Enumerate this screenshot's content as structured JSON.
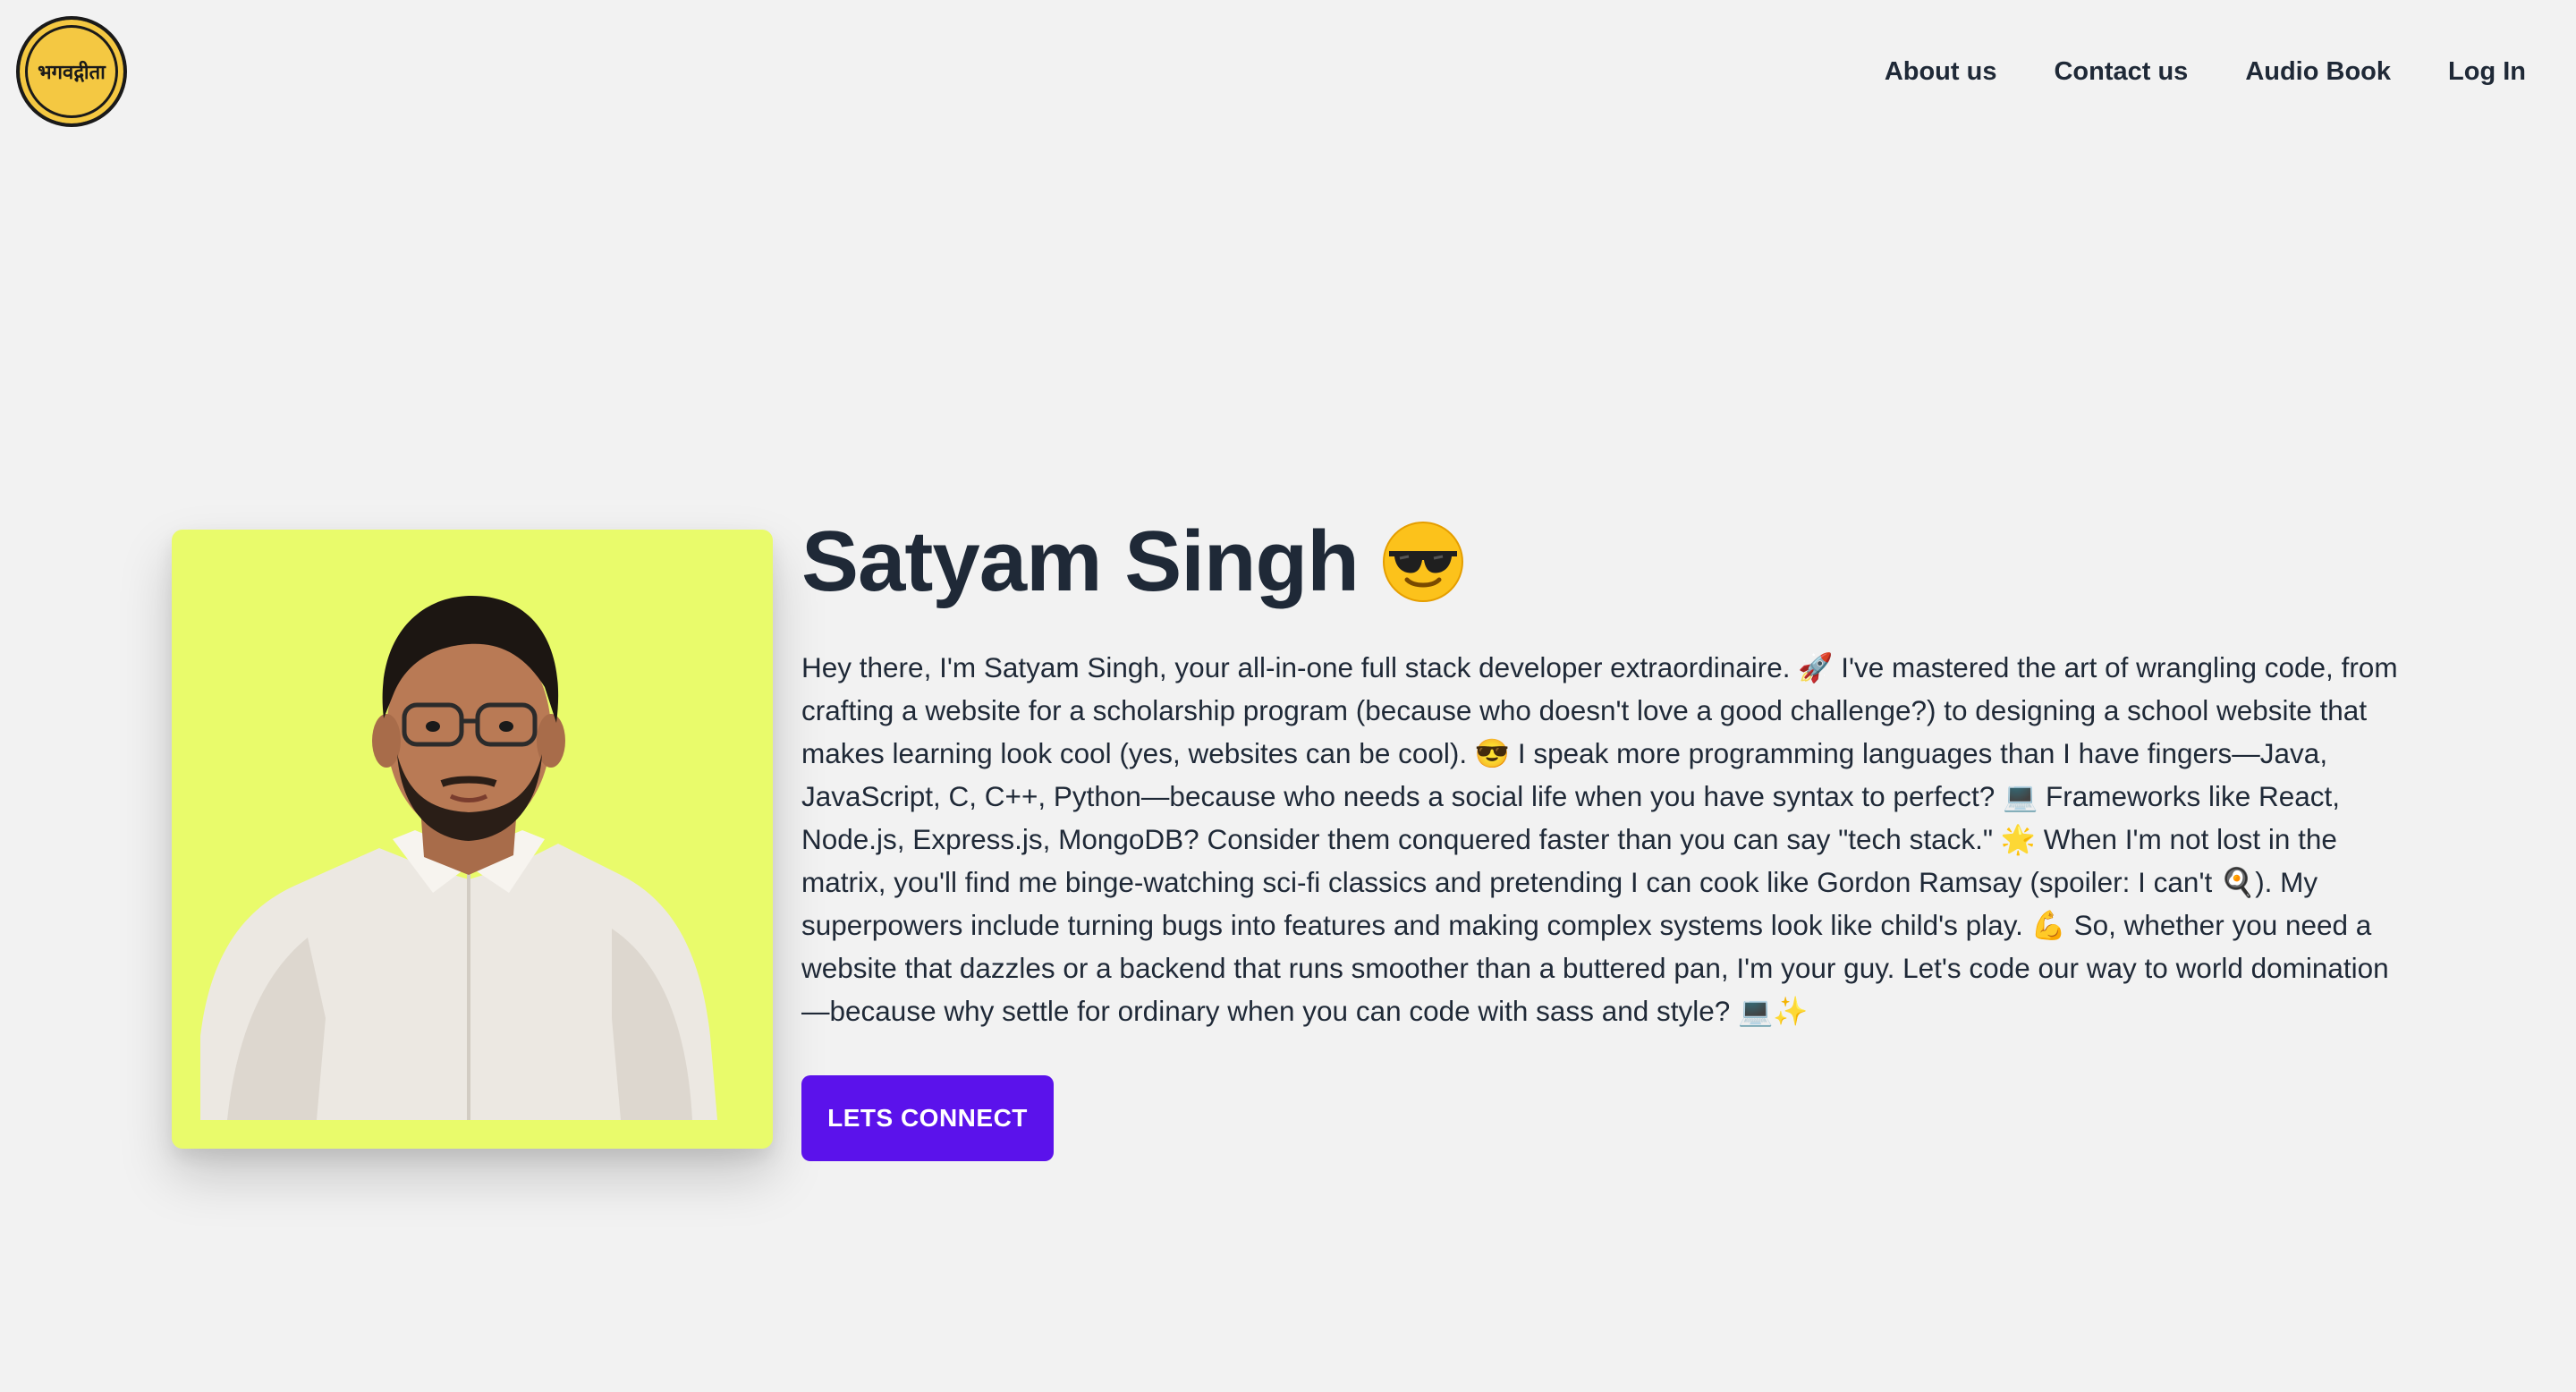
{
  "header": {
    "logo_text": "भगवद्गीता",
    "nav": [
      {
        "label": "About us"
      },
      {
        "label": "Contact us"
      },
      {
        "label": "Audio Book"
      },
      {
        "label": "Log In"
      }
    ]
  },
  "hero": {
    "name": "Satyam Singh",
    "name_emoji_icon": "smiling-face-with-sunglasses-icon",
    "bio": "Hey there, I'm Satyam Singh, your all-in-one full stack developer extraordinaire. 🚀 I've mastered the art of wrangling code, from crafting a website for a scholarship program (because who doesn't love a good challenge?) to designing a school website that makes learning look cool (yes, websites can be cool). 😎 I speak more programming languages than I have fingers—Java, JavaScript, C, C++, Python—because who needs a social life when you have syntax to perfect? 💻 Frameworks like React, Node.js, Express.js, MongoDB? Consider them conquered faster than you can say \"tech stack.\" 🌟 When I'm not lost in the matrix, you'll find me binge-watching sci-fi classics and pretending I can cook like Gordon Ramsay (spoiler: I can't 🍳). My superpowers include turning bugs into features and making complex systems look like child's play. 💪 So, whether you need a website that dazzles or a backend that runs smoother than a buttered pan, I'm your guy. Let's code our way to world domination—because why settle for ordinary when you can code with sass and style? 💻✨",
    "cta_label": "LETS CONNECT"
  },
  "colors": {
    "background": "#f2f2f2",
    "photo_background": "#e9fb6b",
    "cta": "#5b12eb",
    "logo": "#f4c842",
    "text": "#1f2937"
  }
}
